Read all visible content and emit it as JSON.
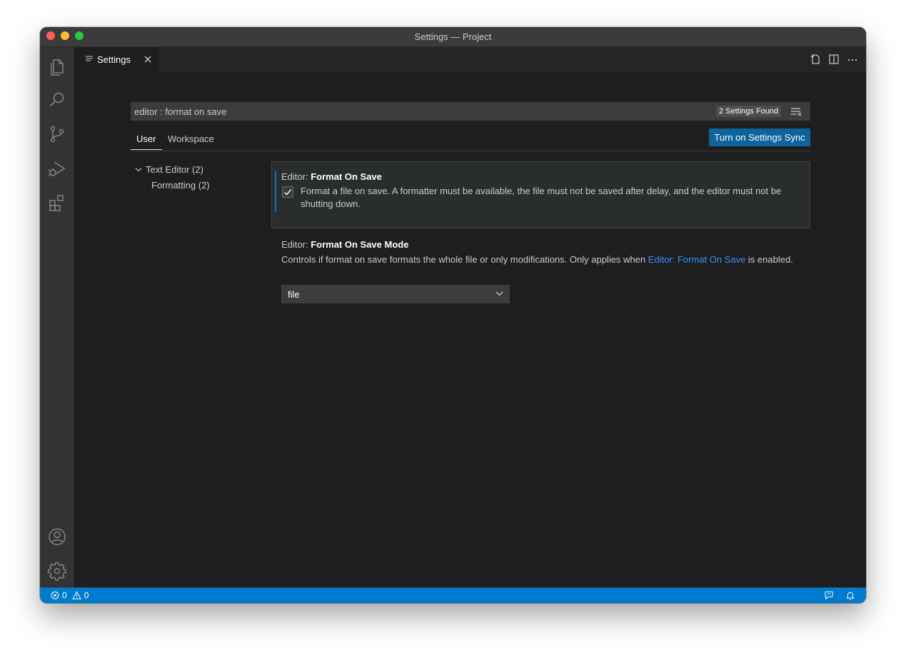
{
  "window": {
    "title": "Settings — Project"
  },
  "activity_bar": {
    "icons": [
      "explorer-icon",
      "search-icon",
      "source-control-icon",
      "run-debug-icon",
      "extensions-icon",
      "accounts-icon",
      "manage-gear-icon"
    ]
  },
  "tab": {
    "label": "Settings"
  },
  "search": {
    "value": "editor : format on save",
    "found_label": "2 Settings Found"
  },
  "scopes": {
    "user": "User",
    "workspace": "Workspace",
    "sync_button": "Turn on Settings Sync"
  },
  "toc": {
    "group_label": "Text Editor (2)",
    "child_label": "Formatting (2)"
  },
  "settings": [
    {
      "category": "Editor: ",
      "name": "Format On Save",
      "checked": true,
      "description": "Format a file on save. A formatter must be available, the file must not be saved after delay, and the editor must not be shutting down."
    },
    {
      "category": "Editor: ",
      "name": "Format On Save Mode",
      "description_before": "Controls if format on save formats the whole file or only modifications. Only applies when ",
      "description_link": "Editor: Format On Save",
      "description_after": " is enabled.",
      "select_value": "file"
    }
  ],
  "status": {
    "errors": "0",
    "warnings": "0"
  },
  "colors": {
    "accent": "#007acc",
    "link": "#3794ff",
    "button": "#0e639c"
  }
}
